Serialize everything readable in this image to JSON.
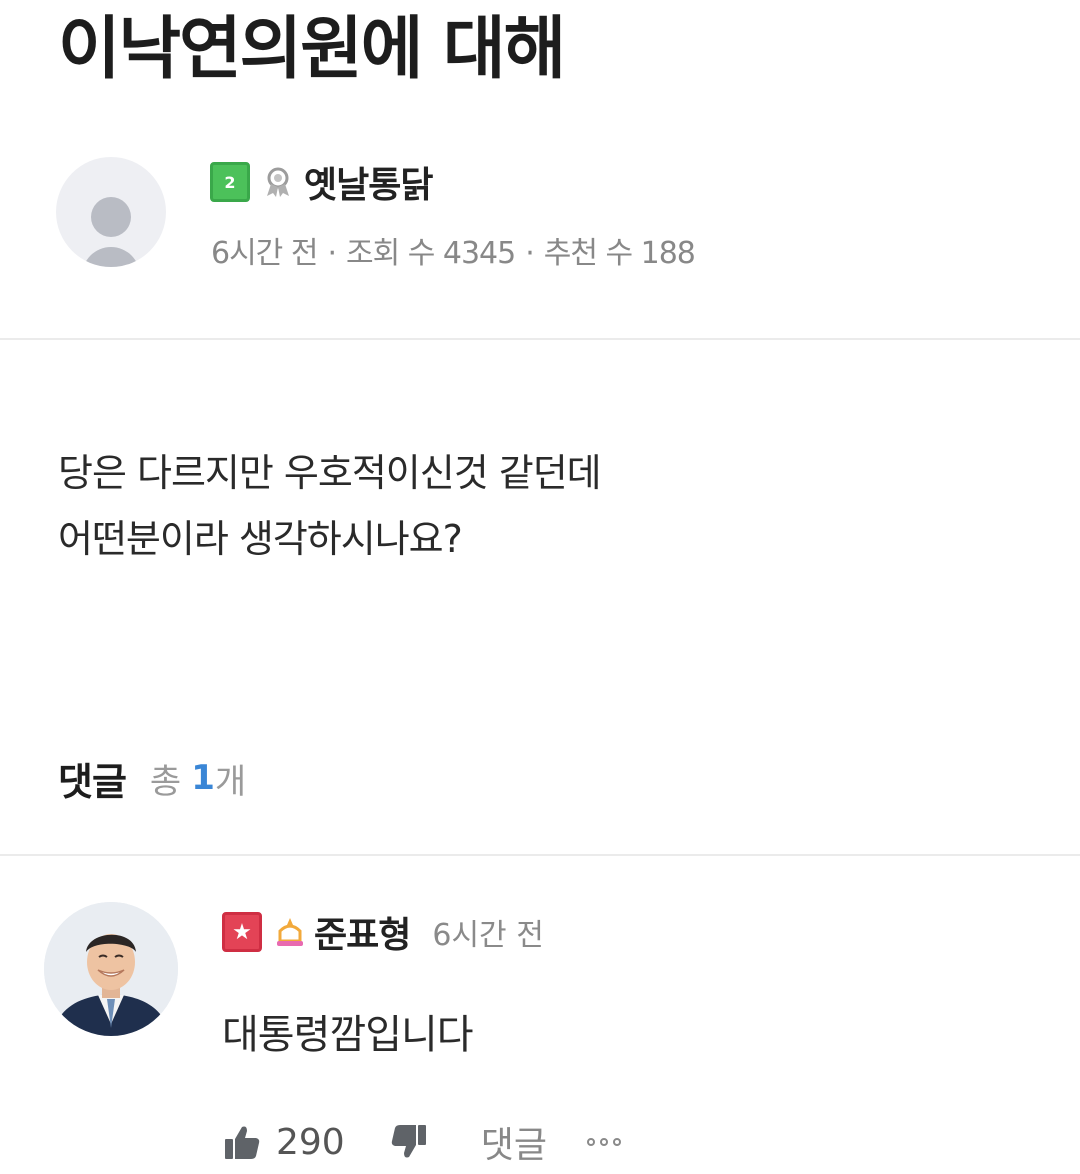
{
  "post": {
    "title": "이낙연의원에 대해",
    "author": {
      "name": "옛날통닭",
      "level_badge": "2",
      "level_color": "#4cc15a",
      "rank_icon": "ribbon-medal-icon"
    },
    "meta": {
      "time": "6시간 전",
      "views": "조회 수 4345",
      "recommends": "추천 수 188",
      "separator": "·"
    },
    "body_lines": [
      "당은 다르지만 우호적이신것 같던데",
      "어떤분이라 생각하시나요?"
    ]
  },
  "comments_section": {
    "label": "댓글",
    "total_prefix": "총",
    "total_count": "1",
    "total_suffix": "개",
    "count_color": "#3a86d6"
  },
  "comment": {
    "author": {
      "name": "준표형",
      "level_badge": "★",
      "level_color": "#e34356",
      "rank_icon": "crown-icon"
    },
    "time": "6시간 전",
    "body": "대통령깜입니다",
    "likes": "290",
    "reply_label": "댓글",
    "more_icon": "more-dots-icon"
  }
}
